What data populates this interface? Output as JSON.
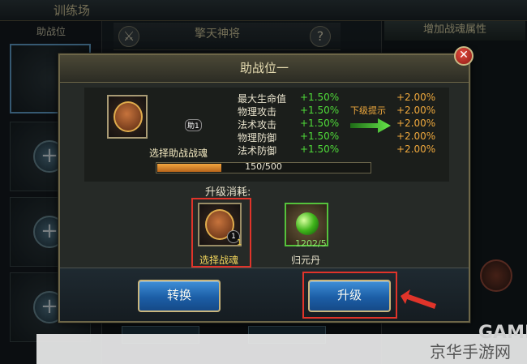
{
  "background": {
    "window_title": "训练场",
    "left_header": "助战位",
    "mid_title": "擎天神将",
    "right_header": "增加战魂属性"
  },
  "dialog": {
    "title": "助战位一",
    "pet_label": "选择助战战魂",
    "pet_badge": "助1",
    "next_hint": "下级提示",
    "stats": [
      {
        "name": "最大生命值",
        "current": "+1.50%",
        "next": "+2.00%"
      },
      {
        "name": "物理攻击",
        "current": "+1.50%",
        "next": "+2.00%"
      },
      {
        "name": "法术攻击",
        "current": "+1.50%",
        "next": "+2.00%"
      },
      {
        "name": "物理防御",
        "current": "+1.50%",
        "next": "+2.00%"
      },
      {
        "name": "法术防御",
        "current": "+1.50%",
        "next": "+2.00%"
      }
    ],
    "progress": {
      "text": "150/500",
      "fraction": 0.3
    },
    "cost_title": "升级消耗:",
    "cost_items": [
      {
        "name": "选择战魂",
        "badge": "1",
        "count": "1"
      },
      {
        "name": "归元丹",
        "count": "1202/5"
      }
    ],
    "buttons": {
      "convert": "转换",
      "upgrade": "升级"
    },
    "close_symbol": "✕"
  },
  "watermark": {
    "site": "京华手游网",
    "logo": "GAME"
  },
  "colors": {
    "bonus_current": "#4fdb39",
    "bonus_next": "#f0a93d",
    "highlight": "#e0342a"
  }
}
